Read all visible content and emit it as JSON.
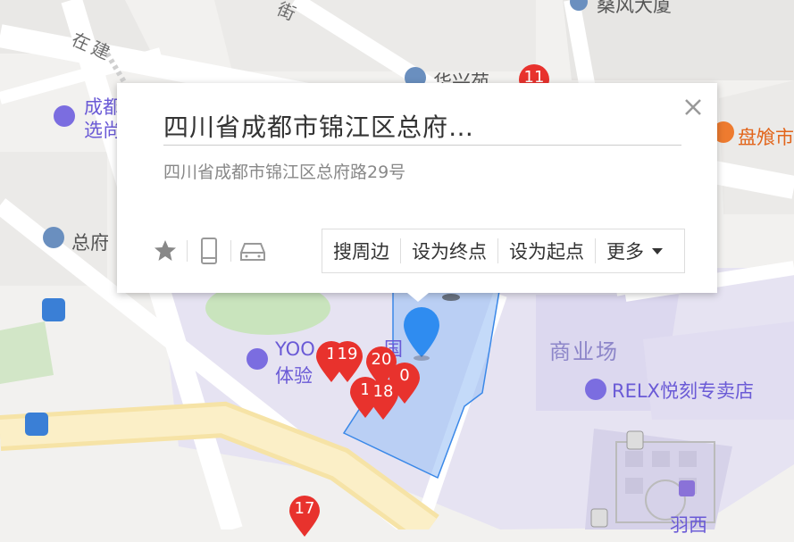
{
  "map": {
    "streets": [
      "在建",
      "街"
    ],
    "pois": {
      "chengdu_xuan": [
        "成都",
        "选尚"
      ],
      "zongfu": "总府",
      "yoo_line1": "YOO",
      "yoo_line2": "体验",
      "yoo_extra": "国",
      "relx": "RELX悦刻专卖店",
      "shangyechang": "商业场",
      "panshi": "盘飧市",
      "huaxing": "华兴苑",
      "sunfeng": "桑风大厦",
      "yuxi": "羽西"
    },
    "markers": [
      "11",
      "19",
      "20",
      "1",
      "18",
      "1",
      "0",
      "17"
    ],
    "colors": {
      "marker": "#e8322d",
      "highlight": "#9cc1f5",
      "pin": "#2f8cf0",
      "road_yellow": "#f6e3a6",
      "district": "#e6e3f2"
    }
  },
  "popup": {
    "title": "四川省成都市锦江区总府…",
    "address": "四川省成都市锦江区总府路29号",
    "close_icon": "close-icon",
    "icons": [
      "star-icon",
      "phone-icon",
      "car-icon"
    ],
    "actions": {
      "nearby": "搜周边",
      "set_end": "设为终点",
      "set_start": "设为起点",
      "more": "更多"
    }
  }
}
